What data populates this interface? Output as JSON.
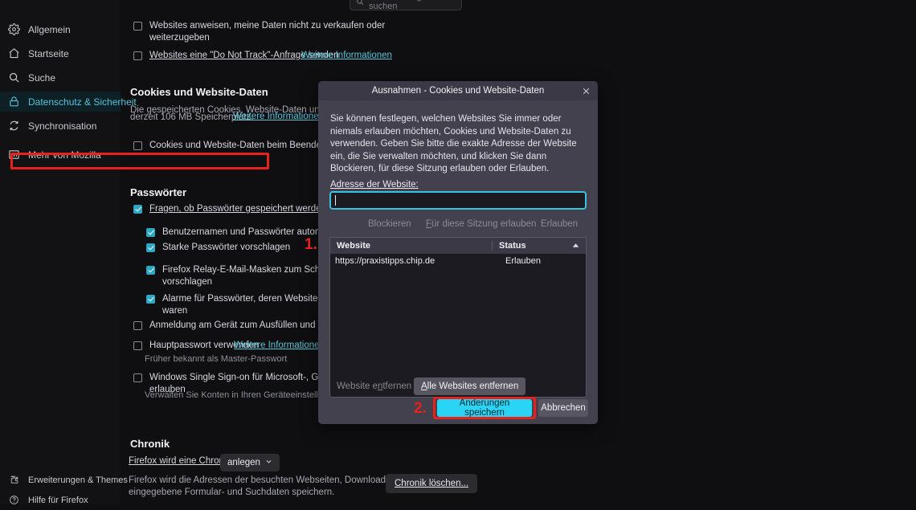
{
  "search": {
    "placeholder": "In Einstellungen suchen",
    "icon": "search-icon"
  },
  "sidebar": {
    "items": [
      {
        "label": "Allgemein",
        "icon": "gear-icon",
        "active": false
      },
      {
        "label": "Startseite",
        "icon": "home-icon",
        "active": false
      },
      {
        "label": "Suche",
        "icon": "search-icon",
        "active": false
      },
      {
        "label": "Datenschutz & Sicherheit",
        "icon": "lock-icon",
        "active": true
      },
      {
        "label": "Synchronisation",
        "icon": "sync-icon",
        "active": false
      },
      {
        "label": "Mehr von Mozilla",
        "icon": "mozilla-icon",
        "active": false
      }
    ],
    "footer": [
      {
        "label": "Erweiterungen & Themes",
        "icon": "puzzle-icon"
      },
      {
        "label": "Hilfe für Firefox",
        "icon": "help-icon"
      }
    ]
  },
  "main": {
    "do_not_sell": {
      "label": "Websites anweisen, meine Daten nicht zu verkaufen oder weiterzugeben",
      "checked": false
    },
    "do_not_track": {
      "label": "Websites eine \"Do Not Track\"-Anfrage senden",
      "link": "Weitere Informationen",
      "checked": false
    },
    "cookies": {
      "title": "Cookies und Website-Daten",
      "desc_line1": "Die gespeicherten Cookies, Website-Daten und der Cach",
      "desc_line2": "derzeit 106 MB Speicherplatz.",
      "desc_link": "Weitere Informationen",
      "clear_on_exit": {
        "label": "Cookies und Website-Daten beim Beenden von Firefo",
        "checked": false
      }
    },
    "passwords": {
      "title": "Passwörter",
      "items": [
        {
          "label": "Fragen, ob Passwörter gespeichert werden sollen",
          "checked": true,
          "indent": 0
        },
        {
          "label": "Benutzernamen und Passwörter automatisch ausf",
          "checked": true,
          "indent": 1
        },
        {
          "label": "Starke Passwörter vorschlagen",
          "checked": true,
          "indent": 1
        },
        {
          "label": "Firefox Relay-E-Mail-Masken zum Schutz Ihrer E-",
          "label2": "vorschlagen",
          "checked": true,
          "indent": 1
        },
        {
          "label": "Alarme für Passwörter, deren Websites von einem",
          "label2": "waren",
          "checked": true,
          "indent": 1
        },
        {
          "label": "Anmeldung am Gerät zum Ausfüllen und Verwalten v",
          "checked": false,
          "indent": 0
        }
      ],
      "master_password": {
        "label": "Hauptpasswort verwenden",
        "link": "Weitere Informationen",
        "checked": false,
        "sub": "Früher bekannt als Master-Passwort"
      },
      "sso": {
        "label": "Windows Single Sign-on für Microsoft-, Geschäfts- u",
        "label2": "erlauben",
        "checked": false,
        "sub": "Verwalten Sie Konten in Ihren Geräteeinstellungen."
      }
    },
    "history": {
      "title": "Chronik",
      "prefix": "Firefox wird eine Chronik",
      "dropdown_value": "anlegen",
      "desc_line1": "Firefox wird die Adressen der besuchten Webseiten, Downloads sowie",
      "desc_line2": "eingegebene Formular- und Suchdaten speichern.",
      "clear_button": "Chronik löschen..."
    }
  },
  "dialog": {
    "title": "Ausnahmen - Cookies und Website-Daten",
    "close_icon": "close-icon",
    "description": "Sie können festlegen, welchen Websites Sie immer oder niemals erlauben möchten, Cookies und Website-Daten zu verwenden. Geben Sie bitte die exakte Adresse der Website ein, die Sie verwalten möchten, und klicken Sie dann Blockieren, für diese Sitzung erlauben oder Erlauben.",
    "address_label": "Adresse der Website:",
    "address_value": "",
    "address_placeholder": "",
    "action_buttons": [
      {
        "label": "Blockieren",
        "enabled": false
      },
      {
        "label": "Für diese Sitzung erlauben",
        "enabled": false
      },
      {
        "label": "Erlauben",
        "enabled": false
      }
    ],
    "table": {
      "columns": [
        "Website",
        "Status"
      ],
      "sort_icon": "sort-ascending-icon",
      "rows": [
        {
          "website": "https://praxistipps.chip.de",
          "status": "Erlauben",
          "highlighted": true
        }
      ]
    },
    "remove_button": "Website entfernen",
    "remove_all_button": "Alle Websites entfernen",
    "save_button": "Änderungen speichern",
    "cancel_button": "Abbrechen"
  },
  "annotations": [
    {
      "label": "1.",
      "target": "table-row-highlight"
    },
    {
      "label": "2.",
      "target": "save-button-highlight"
    }
  ],
  "colors": {
    "accent": "#2ad4f5",
    "annotation_red": "#e8211c",
    "active_nav": "#54c4d8",
    "link": "#5bc5d8"
  }
}
